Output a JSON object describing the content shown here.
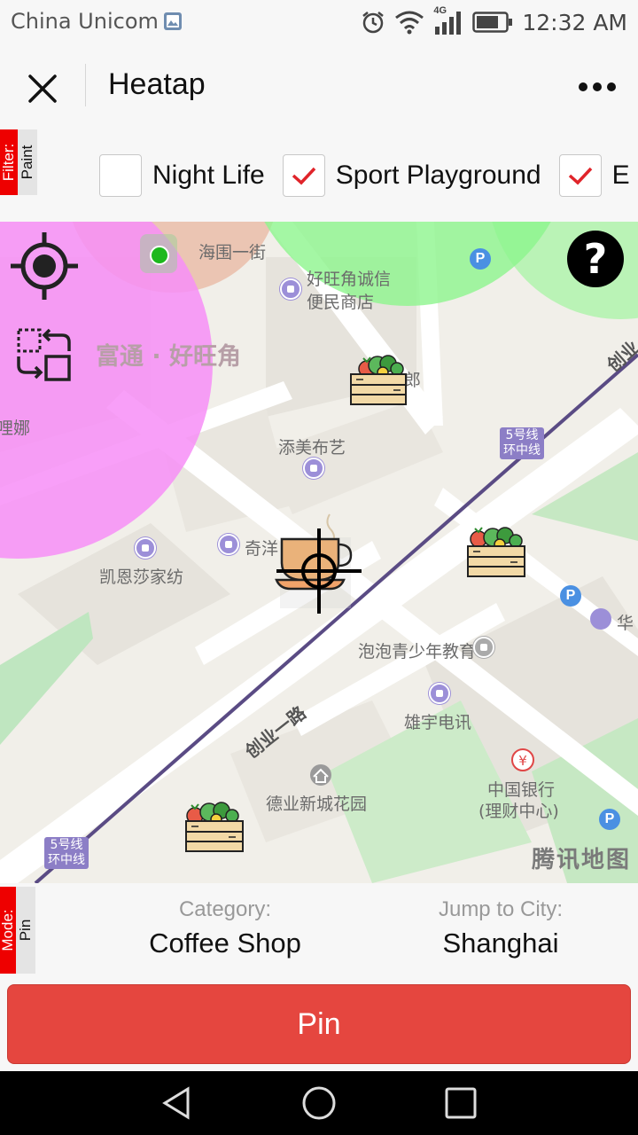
{
  "status_bar": {
    "carrier": "China Unicom",
    "network": "4G",
    "time": "12:32 AM",
    "icons": [
      "image-icon",
      "alarm-icon",
      "wifi-icon",
      "signal-icon",
      "battery-icon"
    ]
  },
  "title_bar": {
    "title": "Heatap",
    "icons": [
      "close-icon",
      "more-icon"
    ]
  },
  "filter": {
    "tag_top": "Filter:",
    "tag_bottom": "Paint",
    "items": [
      {
        "label": "Night Life",
        "checked": false
      },
      {
        "label": "Sport Playground",
        "checked": true
      },
      {
        "label": "E",
        "checked": true
      }
    ]
  },
  "map": {
    "labels": {
      "street_1": "海围一街",
      "store_1": "好旺角诚信",
      "store_2": "便民商店",
      "area": "富通 · 好旺角",
      "left_edge": "哩娜",
      "right_cut": "郎",
      "shop_tianmei": "添美布艺",
      "shop_qiyang": "奇洋",
      "shop_kaien": "凯恩莎家纺",
      "metro_1a": "5号线",
      "metro_1b": "环中线",
      "metro_2a": "5号线",
      "metro_2b": "环中线",
      "road_1": "创业一路",
      "road_2": "创业",
      "edu": "泡泡青少年教育",
      "telecom": "雄宇电讯",
      "garden": "德业新城花园",
      "bank_1": "中国银行",
      "bank_2": "(理财中心)",
      "hua": "华",
      "watermark": "腾讯地图"
    },
    "parking_symbol": "P",
    "help_symbol": "?",
    "heat_colors": {
      "pink": "#f78ef7",
      "green": "#8df58d",
      "orange": "#e8a890"
    },
    "markers": [
      "vegetable-crate-icon",
      "vegetable-crate-icon",
      "vegetable-crate-icon",
      "coffee-cup-icon"
    ],
    "tools": [
      "locate-icon",
      "swap-select-icon",
      "help-icon"
    ]
  },
  "bottom": {
    "mode_top": "Mode:",
    "mode_bottom": "Pin",
    "category_label": "Category:",
    "category_value": "Coffee Shop",
    "city_label": "Jump to City:",
    "city_value": "Shanghai",
    "pin_button": "Pin",
    "accent": "#e5463f"
  },
  "nav_bar": {
    "icons": [
      "back-icon",
      "home-icon",
      "recents-icon"
    ]
  }
}
